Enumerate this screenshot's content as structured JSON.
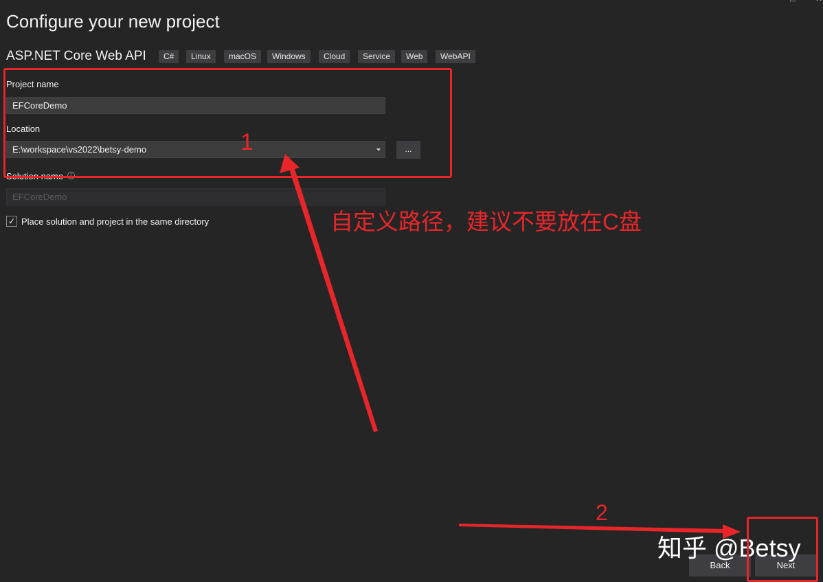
{
  "window": {
    "minimize_glyph": "–",
    "maximize_glyph": "□",
    "close_glyph": "✕"
  },
  "header": {
    "title": "Configure your new project",
    "template_name": "ASP.NET Core Web API",
    "tags": [
      "C#",
      "Linux",
      "macOS",
      "Windows",
      "Cloud",
      "Service",
      "Web",
      "WebAPI"
    ]
  },
  "form": {
    "project_name_label": "Project name",
    "project_name_value": "EFCoreDemo",
    "location_label": "Location",
    "location_value": "E:\\workspace\\vs2022\\betsy-demo",
    "browse_label": "...",
    "solution_name_label": "Solution name",
    "solution_name_info_icon": "i",
    "solution_name_value": "EFCoreDemo",
    "same_directory_checked_glyph": "✓",
    "same_directory_label": "Place solution and project in the same directory"
  },
  "footer": {
    "back_label": "Back",
    "next_label": "Next"
  },
  "annotations": {
    "step1_number": "1",
    "step1_note": "自定义路径，建议不要放在C盘",
    "step2_number": "2",
    "watermark": "知乎 @Betsy",
    "color": "#e8262a"
  },
  "icons": {
    "dropdown": "chevron-down-icon",
    "info": "info-icon",
    "check": "checkmark-icon"
  }
}
